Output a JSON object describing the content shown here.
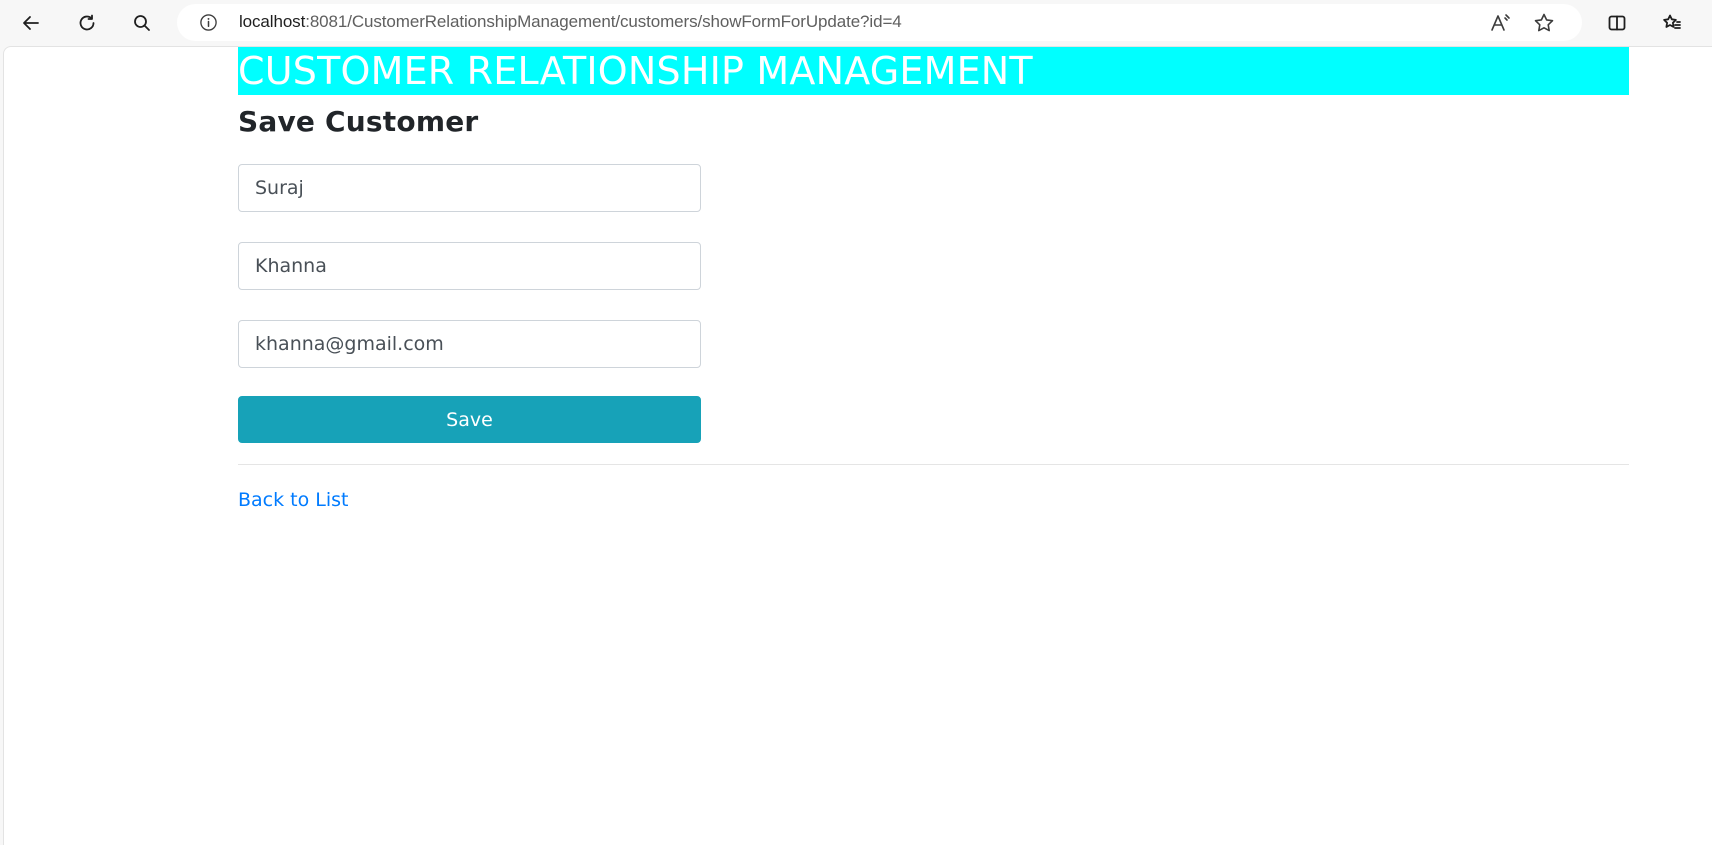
{
  "browser": {
    "url_host": "localhost",
    "url_path": ":8081/CustomerRelationshipManagement/customers/showFormForUpdate?id=4",
    "icons": [
      "back-arrow-icon",
      "refresh-icon",
      "search-icon",
      "info-icon",
      "read-aloud-icon",
      "favorite-star-icon",
      "split-screen-icon",
      "favorites-icon"
    ]
  },
  "page": {
    "banner": "CUSTOMER RELATIONSHIP MANAGEMENT",
    "title": "Save Customer",
    "form": {
      "first_name": "Suraj",
      "last_name": "Khanna",
      "email": "khanna@gmail.com",
      "save_label": "Save"
    },
    "back_link": "Back to List"
  },
  "colors": {
    "banner_bg": "#00ffff",
    "banner_text": "#ffffff",
    "button_bg": "#17a2b8",
    "link": "#007bff"
  }
}
